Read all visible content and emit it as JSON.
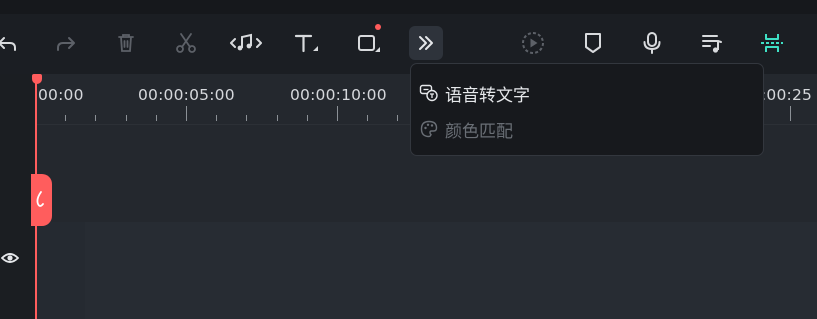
{
  "toolbar": {
    "buttons": [
      {
        "name": "undo-button",
        "icon": "undo-icon",
        "state": "enabled"
      },
      {
        "name": "redo-button",
        "icon": "redo-icon",
        "state": "disabled"
      },
      {
        "name": "delete-button",
        "icon": "trash-icon",
        "state": "disabled"
      },
      {
        "name": "split-button",
        "icon": "scissors-icon",
        "state": "disabled"
      },
      {
        "name": "audio-edit-button",
        "icon": "music-split-icon",
        "state": "enabled"
      },
      {
        "name": "text-button",
        "icon": "text-icon",
        "state": "enabled"
      },
      {
        "name": "crop-button",
        "icon": "crop-icon",
        "state": "enabled",
        "notification_dot": true
      },
      {
        "name": "more-button",
        "icon": "double-chevron-right-icon",
        "state": "active"
      },
      {
        "name": "render-preview-button",
        "icon": "play-circle-dashed-icon",
        "state": "disabled"
      },
      {
        "name": "marker-button",
        "icon": "marker-icon",
        "state": "enabled"
      },
      {
        "name": "voiceover-button",
        "icon": "microphone-icon",
        "state": "enabled"
      },
      {
        "name": "audio-list-button",
        "icon": "music-list-icon",
        "state": "enabled"
      },
      {
        "name": "snap-button",
        "icon": "snap-icon",
        "state": "active",
        "accent": "#3fe0c5"
      }
    ]
  },
  "ruler": {
    "timecodes": [
      "00:00",
      "00:00:05:00",
      "00:00:10:00",
      ":00:25"
    ]
  },
  "more_menu": {
    "items": [
      {
        "label": "语音转文字",
        "icon": "speech-to-text-icon",
        "enabled": true
      },
      {
        "label": "颜色匹配",
        "icon": "palette-icon",
        "enabled": false
      }
    ]
  },
  "tracks": {
    "visibility_icon": "eye-icon"
  },
  "colors": {
    "background": "#1f2228",
    "toolbar": "#1b1e23",
    "playhead": "#ff5d5d",
    "accent": "#3fe0c5"
  }
}
